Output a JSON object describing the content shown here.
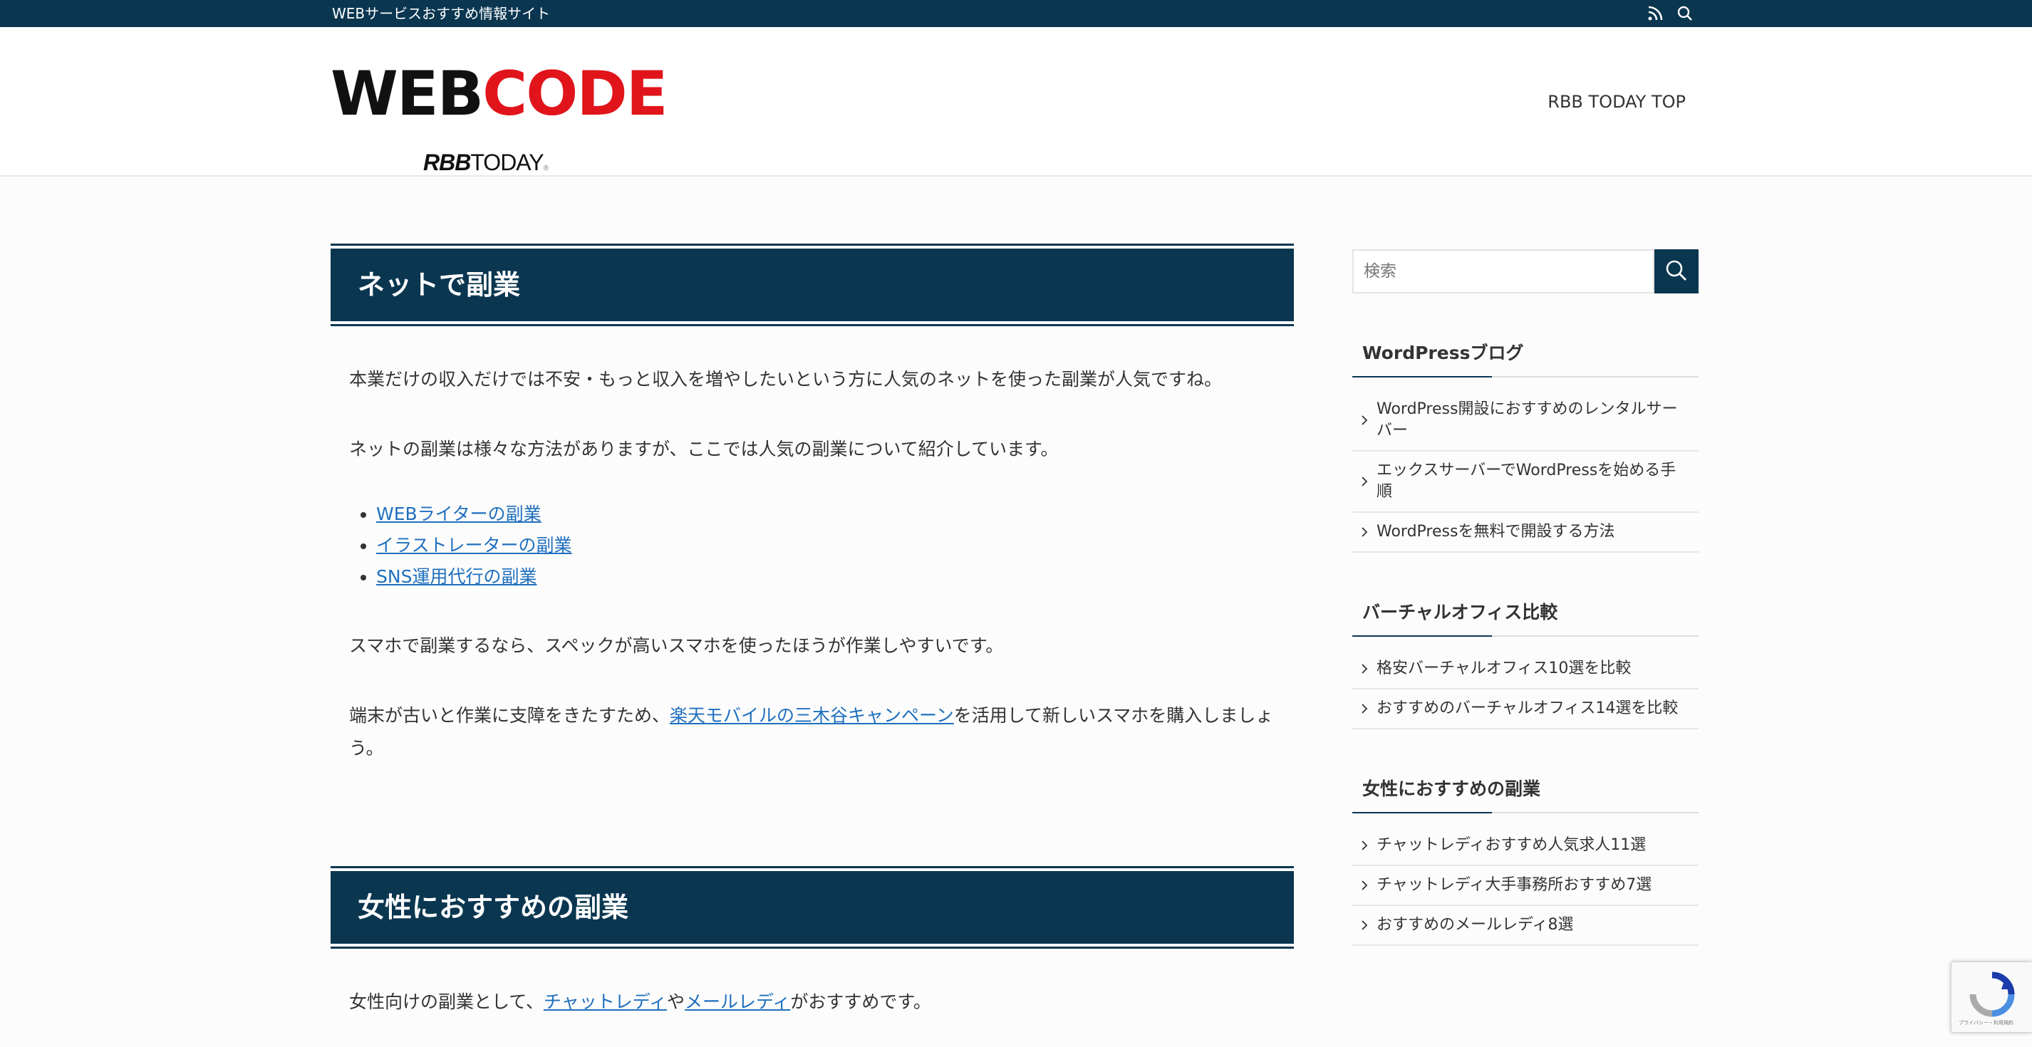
{
  "topbar": {
    "tagline": "WEBサービスおすすめ情報サイト",
    "icons": [
      "rss-icon",
      "search-icon"
    ]
  },
  "header": {
    "logo_part1": "WEB",
    "logo_part2": "CODE",
    "logo_sub_brand": "RBB",
    "logo_sub_name": "TODAY",
    "logo_sub_small": "®",
    "nav_link": "RBB TODAY TOP"
  },
  "colors": {
    "primary": "#0a3650",
    "logo_red": "#e1141b",
    "link": "#1f6fbf"
  },
  "main": {
    "section1": {
      "title": "ネットで副業",
      "para1": "本業だけの収入だけでは不安・もっと収入を増やしたいという方に人気のネットを使った副業が人気ですね。",
      "para2": "ネットの副業は様々な方法がありますが、ここでは人気の副業について紹介しています。",
      "links": [
        "WEBライターの副業",
        "イラストレーターの副業",
        "SNS運用代行の副業"
      ],
      "para3": "スマホで副業するなら、スペックが高いスマホを使ったほうが作業しやすいです。",
      "para4_before": "端末が古いと作業に支障をきたすため、",
      "para4_link": "楽天モバイルの三木谷キャンペーン",
      "para4_after": "を活用して新しいスマホを購入しましょう。"
    },
    "section2": {
      "title": "女性におすすめの副業",
      "para_before": "女性向けの副業として、",
      "link1": "チャットレディ",
      "mid": "や",
      "link2": "メールレディ",
      "para_after": "がおすすめです。"
    }
  },
  "sidebar": {
    "search_placeholder": "検索",
    "widgets": [
      {
        "title": "WordPressブログ",
        "items": [
          "WordPress開設におすすめのレンタルサーバー",
          "エックスサーバーでWordPressを始める手順",
          "WordPressを無料で開設する方法"
        ]
      },
      {
        "title": "バーチャルオフィス比較",
        "items": [
          "格安バーチャルオフィス10選を比較",
          "おすすめのバーチャルオフィス14選を比較"
        ]
      },
      {
        "title": "女性におすすめの副業",
        "items": [
          "チャットレディおすすめ人気求人11選",
          "チャットレディ大手事務所おすすめ7選",
          "おすすめのメールレディ8選"
        ]
      }
    ]
  },
  "recaptcha": {
    "text": "プライバシー・利用規約"
  }
}
